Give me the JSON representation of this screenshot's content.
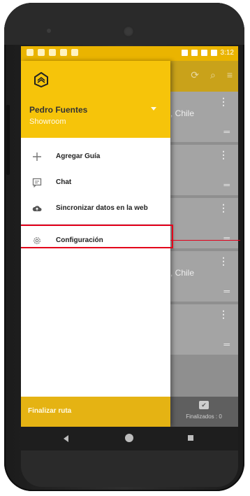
{
  "status_bar": {
    "time": "3:12"
  },
  "app_bar": {
    "icons": [
      "sync-icon",
      "search-icon",
      "filter-list-icon"
    ]
  },
  "cards": [
    {
      "location": ", Chile",
      "menu": "⋮",
      "handle": "═"
    },
    {
      "location": "",
      "menu": "⋮",
      "handle": "═"
    },
    {
      "location": "",
      "menu": "⋮",
      "handle": "═"
    },
    {
      "location": ", Chile",
      "menu": "⋮",
      "handle": "═"
    },
    {
      "location": "",
      "menu": "⋮",
      "handle": "═"
    }
  ],
  "bottom_bar": {
    "finalizados_label": "Finalizados : 0"
  },
  "drawer": {
    "user": {
      "name": "Pedro Fuentes",
      "role": "Showroom"
    },
    "menu": [
      {
        "label": "Agregar Guía",
        "icon": "plus-icon"
      },
      {
        "label": "Chat",
        "icon": "chat-icon"
      },
      {
        "label": "Sincronizar datos en la web",
        "icon": "cloud-upload-icon"
      },
      {
        "label": "Configuración",
        "icon": "gear-icon"
      }
    ],
    "footer": "Finalizar ruta"
  },
  "colors": {
    "header": "#f6c40a",
    "statusbar": "#eab400",
    "highlight": "#e3001b"
  }
}
